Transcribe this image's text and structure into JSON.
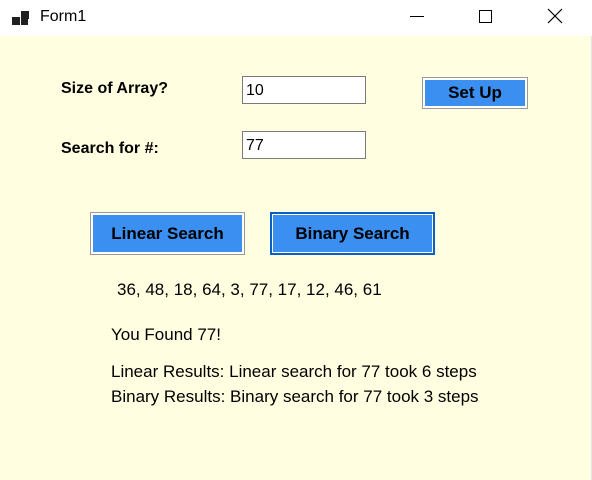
{
  "window": {
    "title": "Form1",
    "icon": "winforms-app-icon"
  },
  "form": {
    "size_label": "Size of Array?",
    "size_value": "10",
    "search_label": "Search for #:",
    "search_value": "77",
    "setup_button": "Set Up",
    "linear_button": "Linear Search",
    "binary_button": "Binary Search",
    "array_display": "36, 48, 18, 64, 3, 77, 17, 12, 46, 61",
    "found_text": "You Found 77!",
    "linear_results": "Linear Results: Linear search for 77 took 6 steps",
    "binary_results": "Binary Results: Binary search for 77 took 3 steps"
  },
  "colors": {
    "form_background": "#fffee0",
    "button_accent": "#3a8ff0"
  }
}
